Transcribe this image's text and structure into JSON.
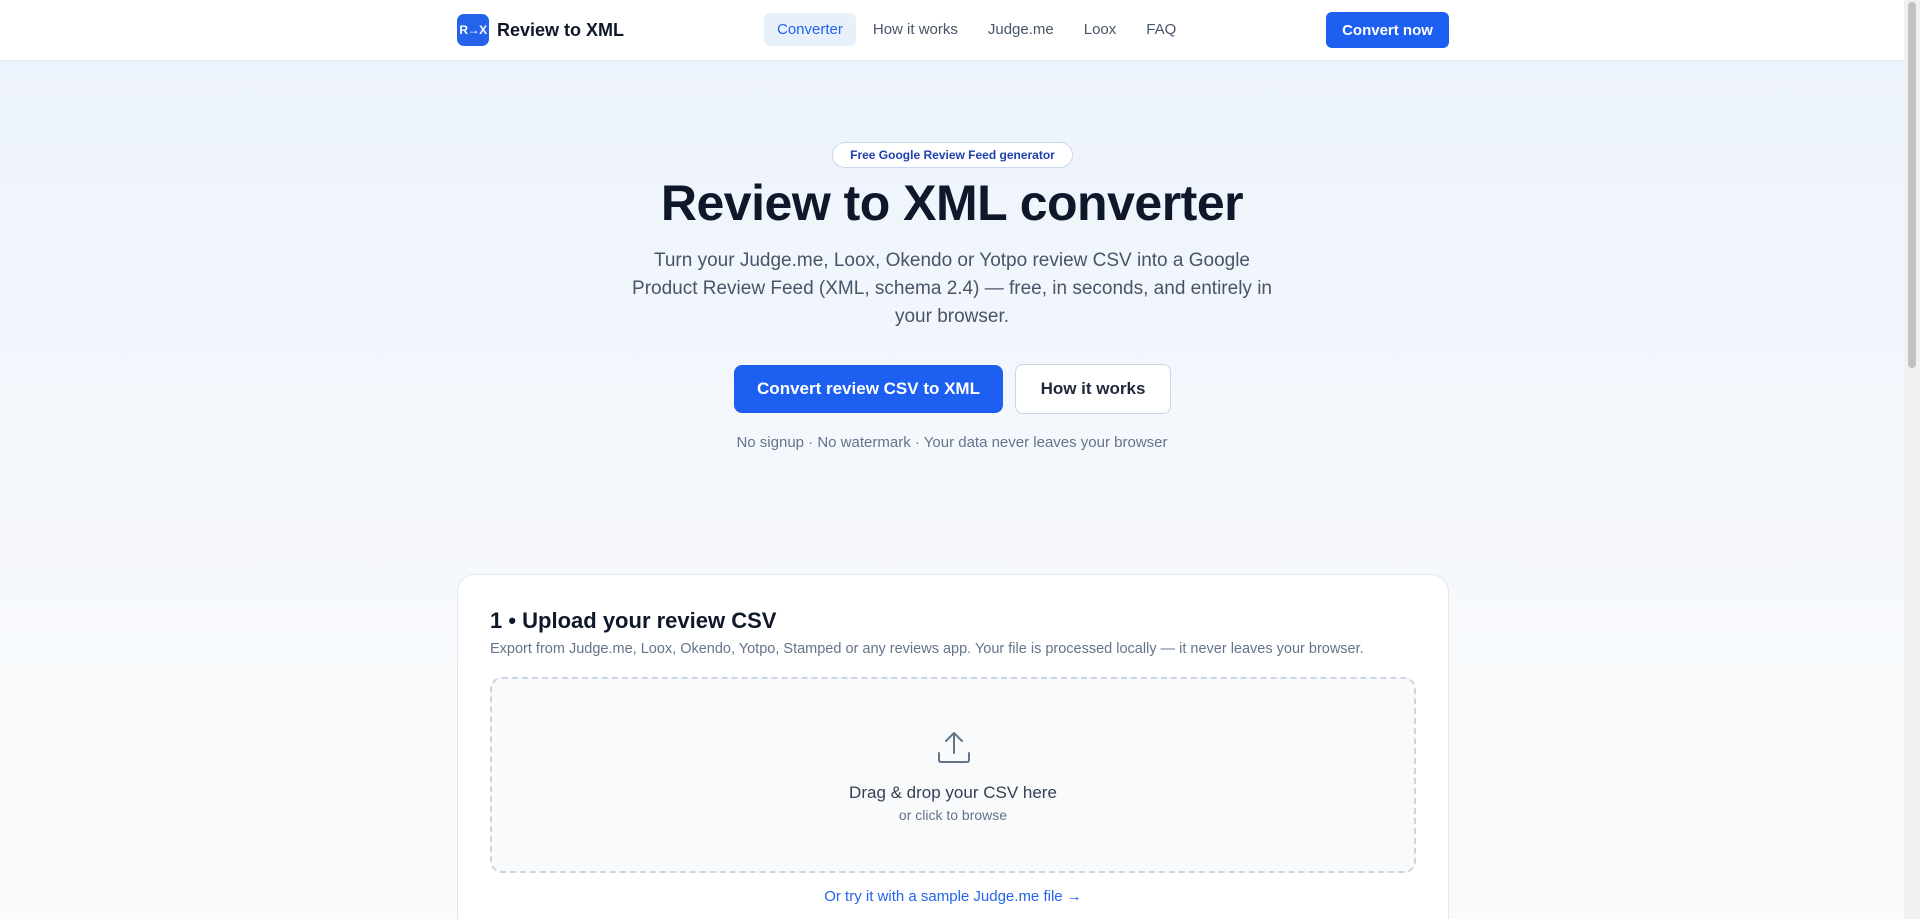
{
  "header": {
    "logo_badge": "R→X",
    "logo_text": "Review to XML",
    "nav": [
      {
        "label": "Converter",
        "active": true
      },
      {
        "label": "How it works"
      },
      {
        "label": "Judge.me"
      },
      {
        "label": "Loox"
      },
      {
        "label": "FAQ"
      }
    ],
    "cta": "Convert now"
  },
  "hero": {
    "pill": "Free Google Review Feed generator",
    "title": "Review to XML converter",
    "subtitle": "Turn your Judge.me, Loox, Okendo or Yotpo review CSV into a Google Product Review Feed (XML, schema 2.4) — free, in seconds, and entirely in your browser.",
    "primary_button": "Convert review CSV to XML",
    "secondary_button": "How it works",
    "note": "No signup · No watermark · Your data never leaves your browser"
  },
  "upload": {
    "title": "1 • Upload your review CSV",
    "description": "Export from Judge.me, Loox, Okendo, Yotpo, Stamped or any reviews app. Your file is processed locally — it never leaves your browser.",
    "drop_main": "Drag & drop your CSV here",
    "drop_sub": "or click to browse",
    "sample_link": "Or try it with a sample Judge.me file →",
    "icon": "upload-icon"
  },
  "colors": {
    "accent": "#1d5ff0",
    "text": "#0f172a",
    "muted": "#64748b"
  }
}
